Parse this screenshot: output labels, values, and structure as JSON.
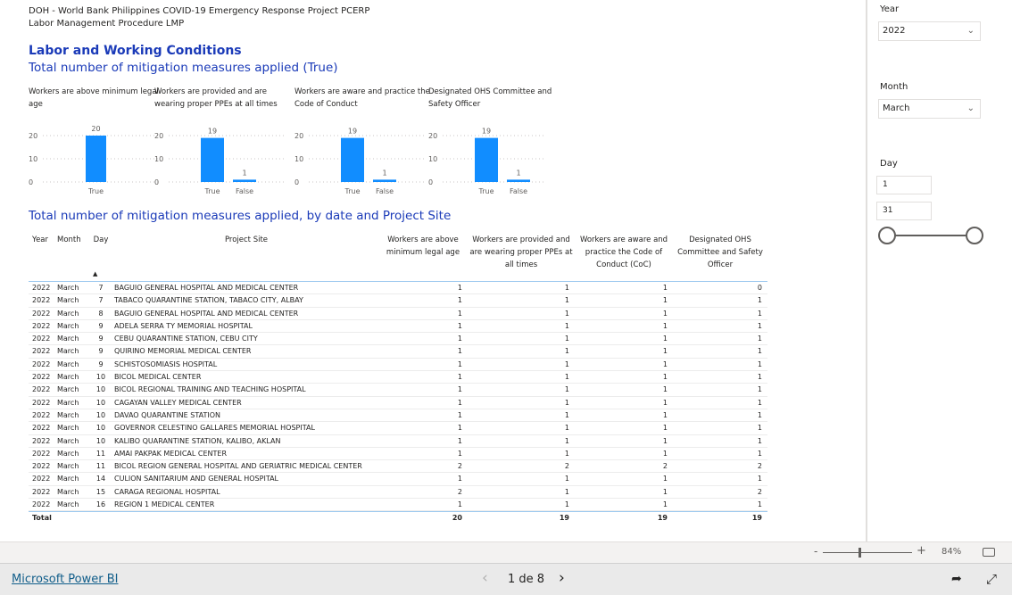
{
  "header": {
    "line1": "DOH - World Bank Philippines COVID-19 Emergency Response Project PCERP",
    "line2": "Labor Management Procedure LMP"
  },
  "section_title": "Labor and Working Conditions",
  "subtitle1": "Total number of mitigation measures applied (True)",
  "subtitle2": "Total number of mitigation measures applied, by date and Project Site",
  "chart_data": [
    {
      "type": "bar",
      "title": "Workers are above minimum legal age",
      "categories": [
        "True"
      ],
      "values": [
        20
      ],
      "ylim": [
        0,
        20
      ],
      "yticks": [
        "0",
        "10",
        "20"
      ],
      "color": "#118dff",
      "grid": true
    },
    {
      "type": "bar",
      "title": "Workers are provided and are wearing proper PPEs at all times",
      "categories": [
        "True",
        "False"
      ],
      "values": [
        19,
        1
      ],
      "ylim": [
        0,
        20
      ],
      "yticks": [
        "0",
        "10",
        "20"
      ],
      "color": "#118dff",
      "grid": true
    },
    {
      "type": "bar",
      "title": "Workers are aware and practice the Code of Conduct",
      "categories": [
        "True",
        "False"
      ],
      "values": [
        19,
        1
      ],
      "ylim": [
        0,
        20
      ],
      "yticks": [
        "0",
        "10",
        "20"
      ],
      "color": "#118dff",
      "grid": true
    },
    {
      "type": "bar",
      "title": "Designated OHS Committee and Safety Officer",
      "categories": [
        "True",
        "False"
      ],
      "values": [
        19,
        1
      ],
      "ylim": [
        0,
        20
      ],
      "yticks": [
        "0",
        "10",
        "20"
      ],
      "color": "#118dff",
      "grid": true
    }
  ],
  "table": {
    "headers": [
      "Year",
      "Month",
      "Day",
      "Project Site",
      "Workers are above minimum legal age",
      "Workers are provided and are wearing proper PPEs at all times",
      "Workers are aware and practice the Code of Conduct (CoC)",
      "Designated OHS Committee and Safety Officer"
    ],
    "sort_indicator": "▲",
    "rows": [
      [
        "2022",
        "March",
        "7",
        "BAGUIO GENERAL HOSPITAL AND MEDICAL CENTER",
        "1",
        "1",
        "1",
        "0"
      ],
      [
        "2022",
        "March",
        "7",
        "TABACO QUARANTINE STATION, TABACO CITY, ALBAY",
        "1",
        "1",
        "1",
        "1"
      ],
      [
        "2022",
        "March",
        "8",
        "BAGUIO GENERAL HOSPITAL AND MEDICAL CENTER",
        "1",
        "1",
        "1",
        "1"
      ],
      [
        "2022",
        "March",
        "9",
        "ADELA SERRA TY MEMORIAL HOSPITAL",
        "1",
        "1",
        "1",
        "1"
      ],
      [
        "2022",
        "March",
        "9",
        "CEBU QUARANTINE STATION, CEBU CITY",
        "1",
        "1",
        "1",
        "1"
      ],
      [
        "2022",
        "March",
        "9",
        "QUIRINO MEMORIAL MEDICAL CENTER",
        "1",
        "1",
        "1",
        "1"
      ],
      [
        "2022",
        "March",
        "9",
        "SCHISTOSOMIASIS HOSPITAL",
        "1",
        "1",
        "1",
        "1"
      ],
      [
        "2022",
        "March",
        "10",
        "BICOL MEDICAL CENTER",
        "1",
        "1",
        "1",
        "1"
      ],
      [
        "2022",
        "March",
        "10",
        "BICOL REGIONAL TRAINING AND TEACHING HOSPITAL",
        "1",
        "1",
        "1",
        "1"
      ],
      [
        "2022",
        "March",
        "10",
        "CAGAYAN VALLEY MEDICAL CENTER",
        "1",
        "1",
        "1",
        "1"
      ],
      [
        "2022",
        "March",
        "10",
        "DAVAO QUARANTINE STATION",
        "1",
        "1",
        "1",
        "1"
      ],
      [
        "2022",
        "March",
        "10",
        "GOVERNOR CELESTINO GALLARES MEMORIAL HOSPITAL",
        "1",
        "1",
        "1",
        "1"
      ],
      [
        "2022",
        "March",
        "10",
        "KALIBO QUARANTINE STATION, KALIBO, AKLAN",
        "1",
        "1",
        "1",
        "1"
      ],
      [
        "2022",
        "March",
        "11",
        "AMAI PAKPAK MEDICAL CENTER",
        "1",
        "1",
        "1",
        "1"
      ],
      [
        "2022",
        "March",
        "11",
        "BICOL REGION GENERAL HOSPITAL AND GERIATRIC MEDICAL CENTER",
        "2",
        "2",
        "2",
        "2"
      ],
      [
        "2022",
        "March",
        "14",
        "CULION SANITARIUM AND GENERAL HOSPITAL",
        "1",
        "1",
        "1",
        "1"
      ],
      [
        "2022",
        "March",
        "15",
        "CARAGA REGIONAL HOSPITAL",
        "2",
        "1",
        "1",
        "2"
      ],
      [
        "2022",
        "March",
        "16",
        "REGION 1 MEDICAL CENTER",
        "1",
        "1",
        "1",
        "1"
      ]
    ],
    "total": [
      "Total",
      "",
      "",
      "",
      "20",
      "19",
      "19",
      "19"
    ]
  },
  "filters": {
    "year_label": "Year",
    "year_value": "2022",
    "month_label": "Month",
    "month_value": "March",
    "day_label": "Day",
    "day_from": "1",
    "day_to": "31"
  },
  "zoom": {
    "minus": "-",
    "plus": "+",
    "level": "84%"
  },
  "footer": {
    "brand": "Microsoft Power BI",
    "page": "1 de 8",
    "prev": "‹",
    "next": "›"
  }
}
